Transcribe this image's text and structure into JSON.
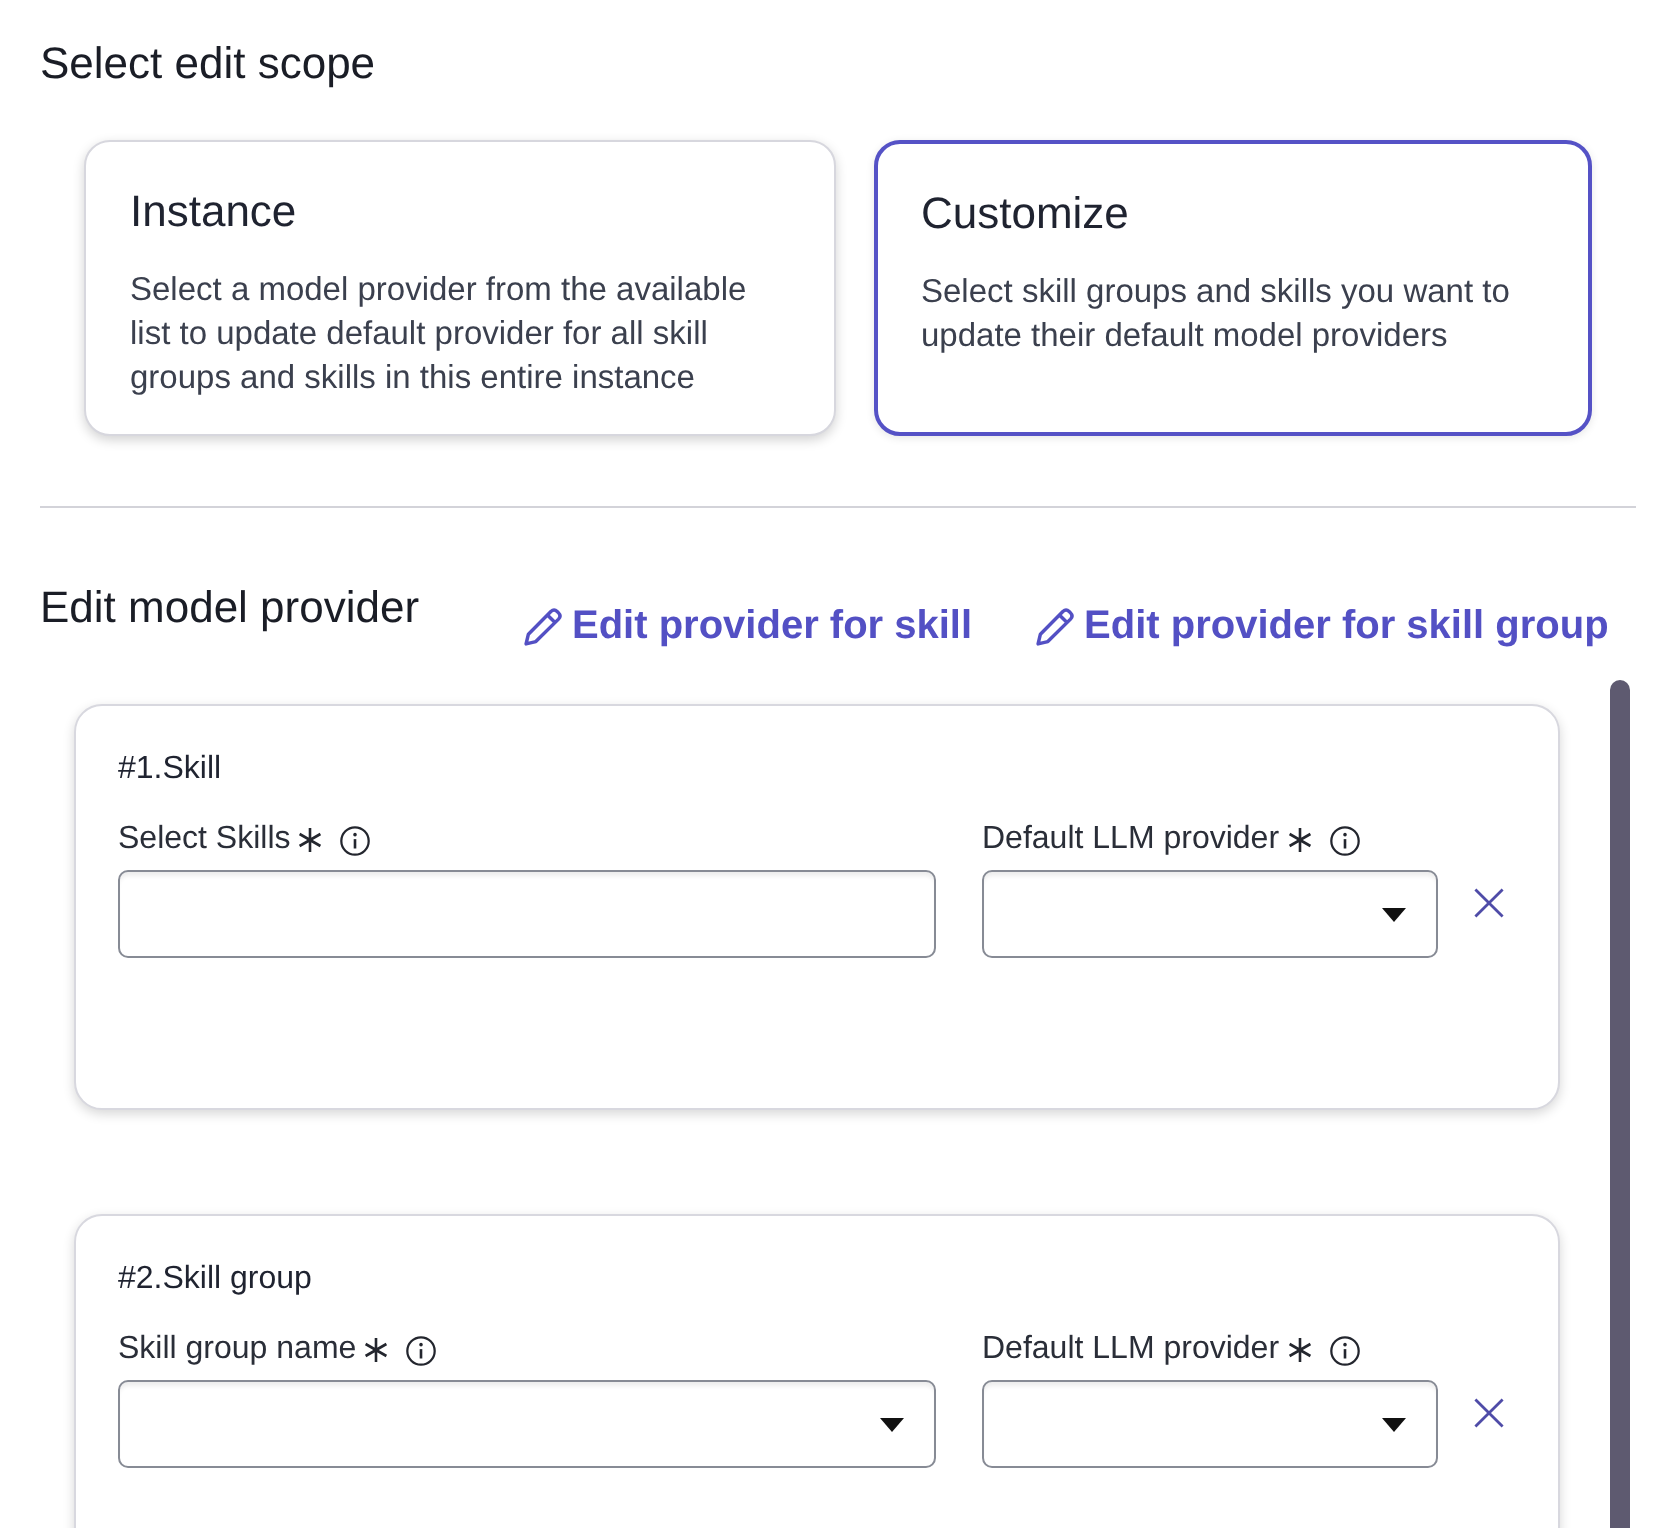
{
  "scope": {
    "title": "Select edit scope",
    "options": [
      {
        "title": "Instance",
        "description": "Select a model provider from the available list to update default provider for all skill groups and skills in this entire instance",
        "selected": false
      },
      {
        "title": "Customize",
        "description": "Select skill groups and skills you want to update their default model providers",
        "selected": true
      }
    ]
  },
  "editor": {
    "title": "Edit model provider",
    "links": [
      {
        "label": "Edit provider for skill"
      },
      {
        "label": "Edit provider for skill group"
      }
    ],
    "entries": [
      {
        "title": "#1.Skill",
        "fields": [
          {
            "kind": "text",
            "label": "Select Skills",
            "required": true
          },
          {
            "kind": "select",
            "label": "Default LLM provider",
            "required": true
          }
        ]
      },
      {
        "title": "#2.Skill group",
        "fields": [
          {
            "kind": "select",
            "label": "Skill group name",
            "required": true
          },
          {
            "kind": "select",
            "label": "Default LLM provider",
            "required": true
          }
        ]
      }
    ]
  }
}
